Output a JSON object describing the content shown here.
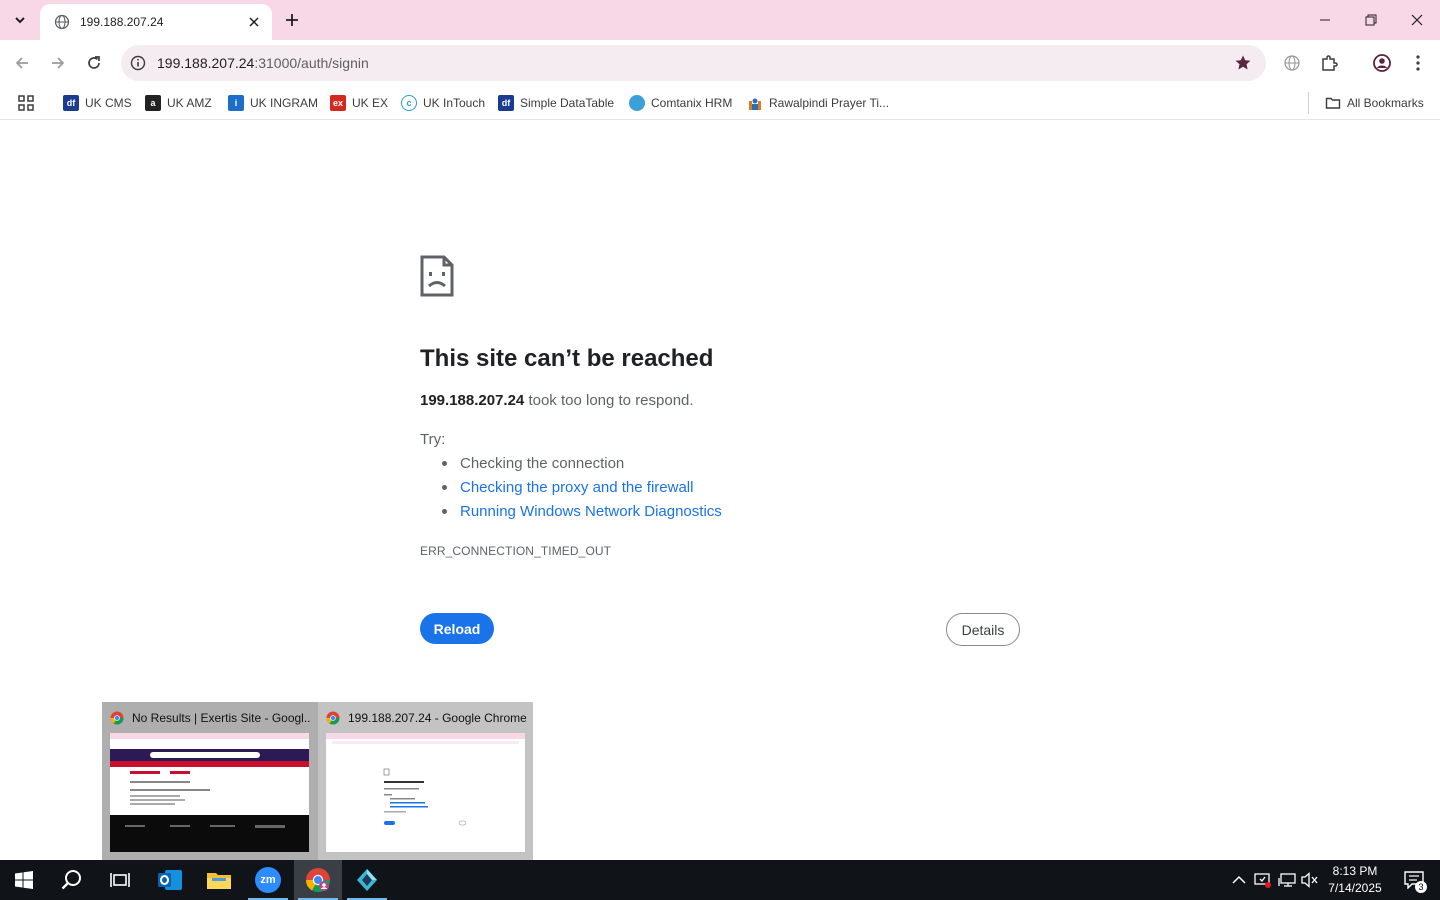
{
  "tab": {
    "title": "199.188.207.24"
  },
  "address_bar": {
    "host": "199.188.207.24",
    "path": ":31000/auth/signin"
  },
  "bookmarks": {
    "items": [
      {
        "label": "UK CMS",
        "icon": "df-icon",
        "color": "#1a3b8f"
      },
      {
        "label": "UK AMZ",
        "icon": "amazon-icon",
        "color": "#222222"
      },
      {
        "label": "UK INGRAM",
        "icon": "ingram-icon",
        "color": "#1b6fc9"
      },
      {
        "label": "UK EX",
        "icon": "ex-icon",
        "color": "#d32a1f"
      },
      {
        "label": "UK InTouch",
        "icon": "intouch-icon",
        "color": "#2a9bd6"
      },
      {
        "label": "Simple DataTable",
        "icon": "df-icon",
        "color": "#1a3b8f"
      },
      {
        "label": "Comtanix HRM",
        "icon": "comtanix-icon",
        "color": "#3aa0d8"
      },
      {
        "label": "Rawalpindi Prayer Ti...",
        "icon": "prayer-icon",
        "color": "#e07a1f"
      }
    ],
    "all_bookmarks": "All Bookmarks"
  },
  "error_page": {
    "title": "This site can’t be reached",
    "host": "199.188.207.24",
    "message_suffix": " took too long to respond.",
    "try_label": "Try:",
    "suggestions": [
      {
        "text": "Checking the connection",
        "link": false
      },
      {
        "text": "Checking the proxy and the firewall",
        "link": true
      },
      {
        "text": "Running Windows Network Diagnostics",
        "link": true
      }
    ],
    "error_code": "ERR_CONNECTION_TIMED_OUT",
    "reload_label": "Reload",
    "details_label": "Details"
  },
  "thumbnails": [
    {
      "title": "No Results | Exertis Site - Googl...",
      "active": false
    },
    {
      "title": "199.188.207.24 - Google Chrome",
      "active": true
    }
  ],
  "taskbar": {
    "apps": [
      "start-icon",
      "search-icon",
      "task-view-icon",
      "outlook-icon",
      "file-explorer-icon",
      "zoom-icon",
      "chrome-icon",
      "app-icon"
    ],
    "zoom_label": "zm",
    "time": "8:13 PM",
    "date": "7/14/2025",
    "notification_count": "3"
  },
  "colors": {
    "tabstrip": "#f8d7e6",
    "accent": "#1a73e8",
    "link": "#1a73e8"
  }
}
